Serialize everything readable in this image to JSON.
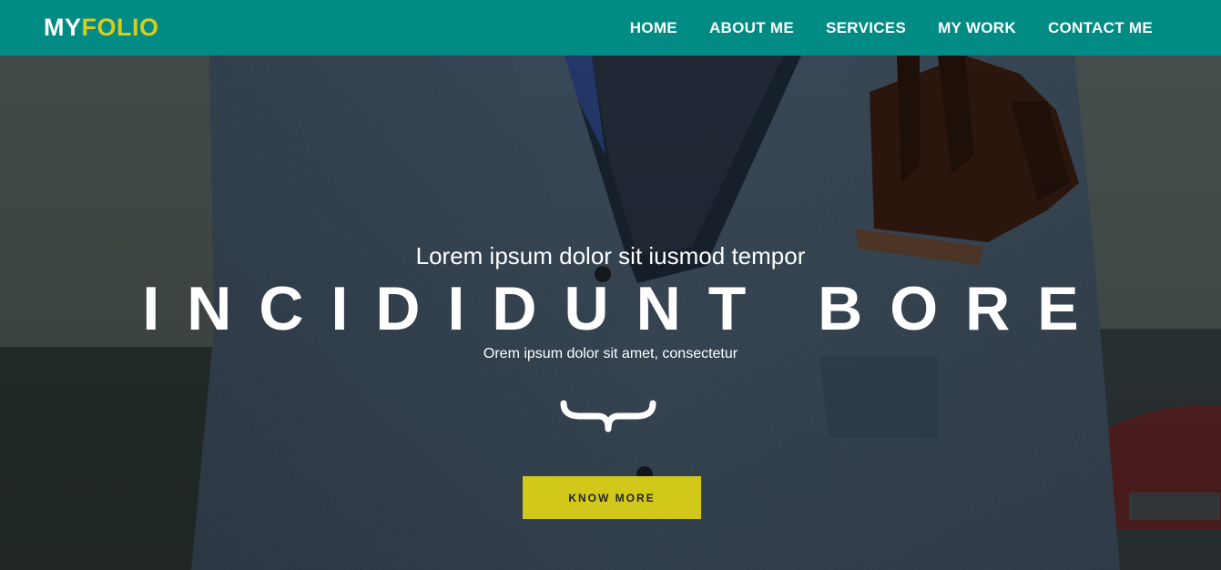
{
  "brand": {
    "logo_part1": "MY",
    "logo_part2": "FOLIO",
    "logo_color_primary": "#ffffff",
    "logo_color_accent": "#d8cb1c"
  },
  "navbar": {
    "background": "#008b84",
    "items": [
      {
        "label": "HOME"
      },
      {
        "label": "ABOUT ME"
      },
      {
        "label": "SERVICES"
      },
      {
        "label": "MY WORK"
      },
      {
        "label": "CONTACT ME"
      }
    ]
  },
  "hero": {
    "kicker": "Lorem ipsum dolor sit iusmod tempor",
    "headline": "INCIDIDUNT BORE",
    "subline": "Orem ipsum dolor sit amet, consectetur",
    "divider_icon": "curly-brace-icon",
    "cta_label": "KNOW MORE",
    "cta_color": "#d2c81a",
    "background_image": "man-in-grey-tweed-jacket-with-gloves-in-pocket"
  }
}
